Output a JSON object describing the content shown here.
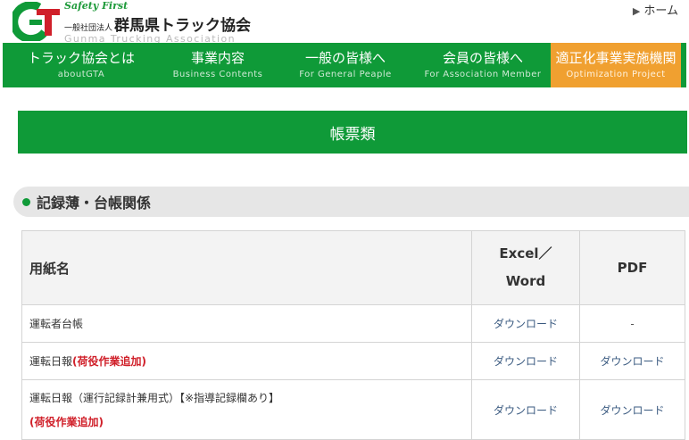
{
  "header": {
    "tagline": "Safety First",
    "org_prefix": "一般社団法人",
    "org_name": "群馬県トラック協会",
    "org_name_en": "Gunma Trucking Association",
    "home_link": "ホーム"
  },
  "nav": {
    "items": [
      {
        "label": "トラック協会とは",
        "sub": "aboutGTA"
      },
      {
        "label": "事業内容",
        "sub": "Business Contents"
      },
      {
        "label": "一般の皆様へ",
        "sub": "For General Peaple"
      },
      {
        "label": "会員の皆様へ",
        "sub": "For Association Member"
      },
      {
        "label": "適正化事業実施機関",
        "sub": "Optimization Project"
      }
    ],
    "highlight_color": "#f0a030",
    "bar_color": "#0f9a38"
  },
  "page_title": "帳票類",
  "section": {
    "heading": "記録薄・台帳関係"
  },
  "table": {
    "headers": {
      "name": "用紙名",
      "excel_1": "Excel／",
      "excel_2": "Word",
      "pdf": "PDF"
    },
    "rows": [
      {
        "name": "運転者台帳",
        "note": "",
        "excel": "ダウンロード",
        "pdf": "-"
      },
      {
        "name": "運転日報",
        "note": "(荷役作業追加)",
        "excel": "ダウンロード",
        "pdf": "ダウンロード"
      },
      {
        "name": "運転日報（運行記録計兼用式）【※指導記録欄あり】",
        "note": "(荷役作業追加)",
        "excel": "ダウンロード",
        "pdf": "ダウンロード"
      }
    ]
  }
}
